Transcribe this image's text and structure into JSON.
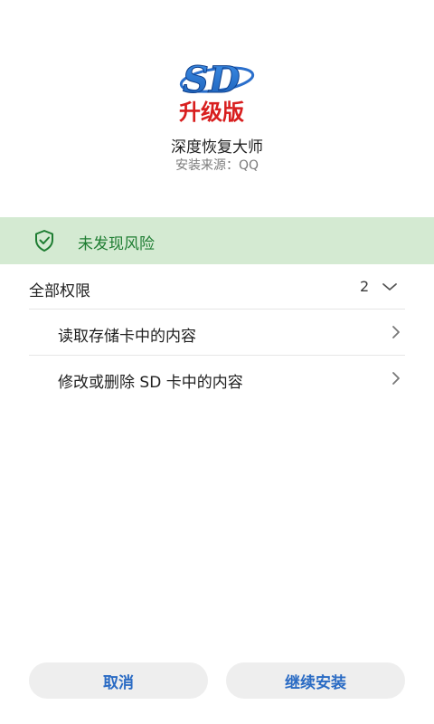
{
  "app": {
    "icon": "sd-recovery-app-icon",
    "icon_text_top": "SD",
    "icon_text_bottom": "升级版",
    "name": "深度恢复大师",
    "source": "安装来源：QQ"
  },
  "risk": {
    "icon": "shield-check-icon",
    "text": "未发现风险",
    "color": "#1e7d32",
    "background": "#d4ead2"
  },
  "permissions": {
    "title": "全部权限",
    "count": "2",
    "items": [
      {
        "label": "读取存储卡中的内容"
      },
      {
        "label": "修改或删除 SD 卡中的内容"
      }
    ]
  },
  "buttons": {
    "cancel": "取消",
    "continue": "继续安装",
    "accent": "#2a6bc4"
  }
}
